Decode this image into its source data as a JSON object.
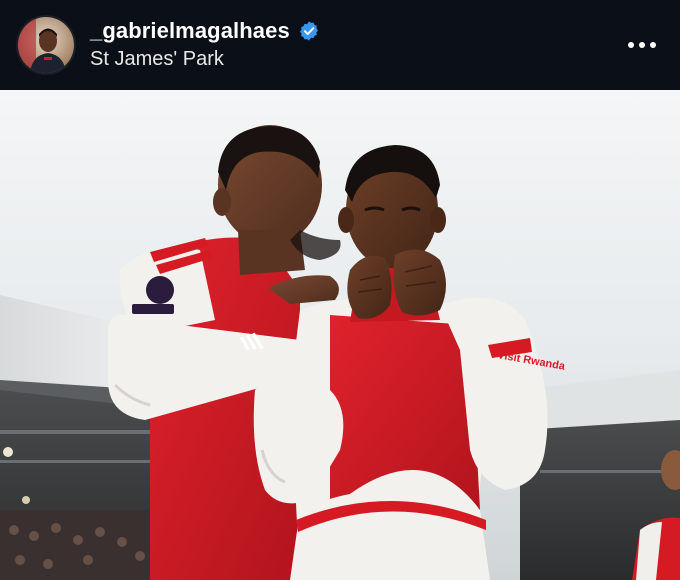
{
  "header": {
    "username": "_gabrielmagalhaes",
    "location": "St James' Park",
    "verified_icon": "verified-badge-icon",
    "more_icon": "more-options-icon",
    "verified_color": "#3897f0"
  },
  "photo": {
    "description_icon": "photo-image",
    "sleeve_patch_text": "Visit Rwanda",
    "kit_colors": {
      "red": "#d61a24",
      "white": "#f3f1ee",
      "skin": "#6b3f2a"
    }
  }
}
